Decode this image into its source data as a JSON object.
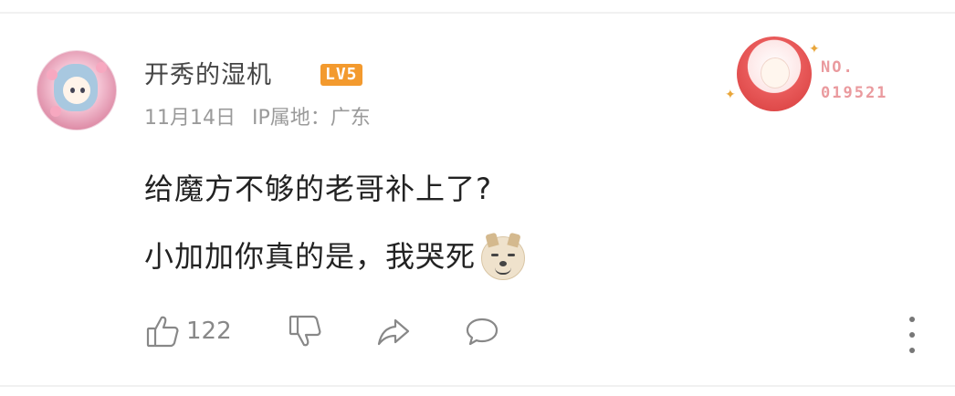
{
  "user": {
    "name": "开秀的湿机",
    "level_badge": "LV5",
    "date": "11月14日",
    "ip_location": "IP属地：广东"
  },
  "fan_badge": {
    "label": "NO.",
    "number": "019521"
  },
  "comment": {
    "line1": "给魔方不够的老哥补上了?",
    "line2": "小加加你真的是，我哭死",
    "emoji": "dog-emoji"
  },
  "actions": {
    "like_count": "122"
  },
  "colors": {
    "level_badge": "#f39a2e",
    "fan_badge_text": "#ea9a9e",
    "meta_text": "#9a9a9a",
    "icon": "#888888"
  }
}
